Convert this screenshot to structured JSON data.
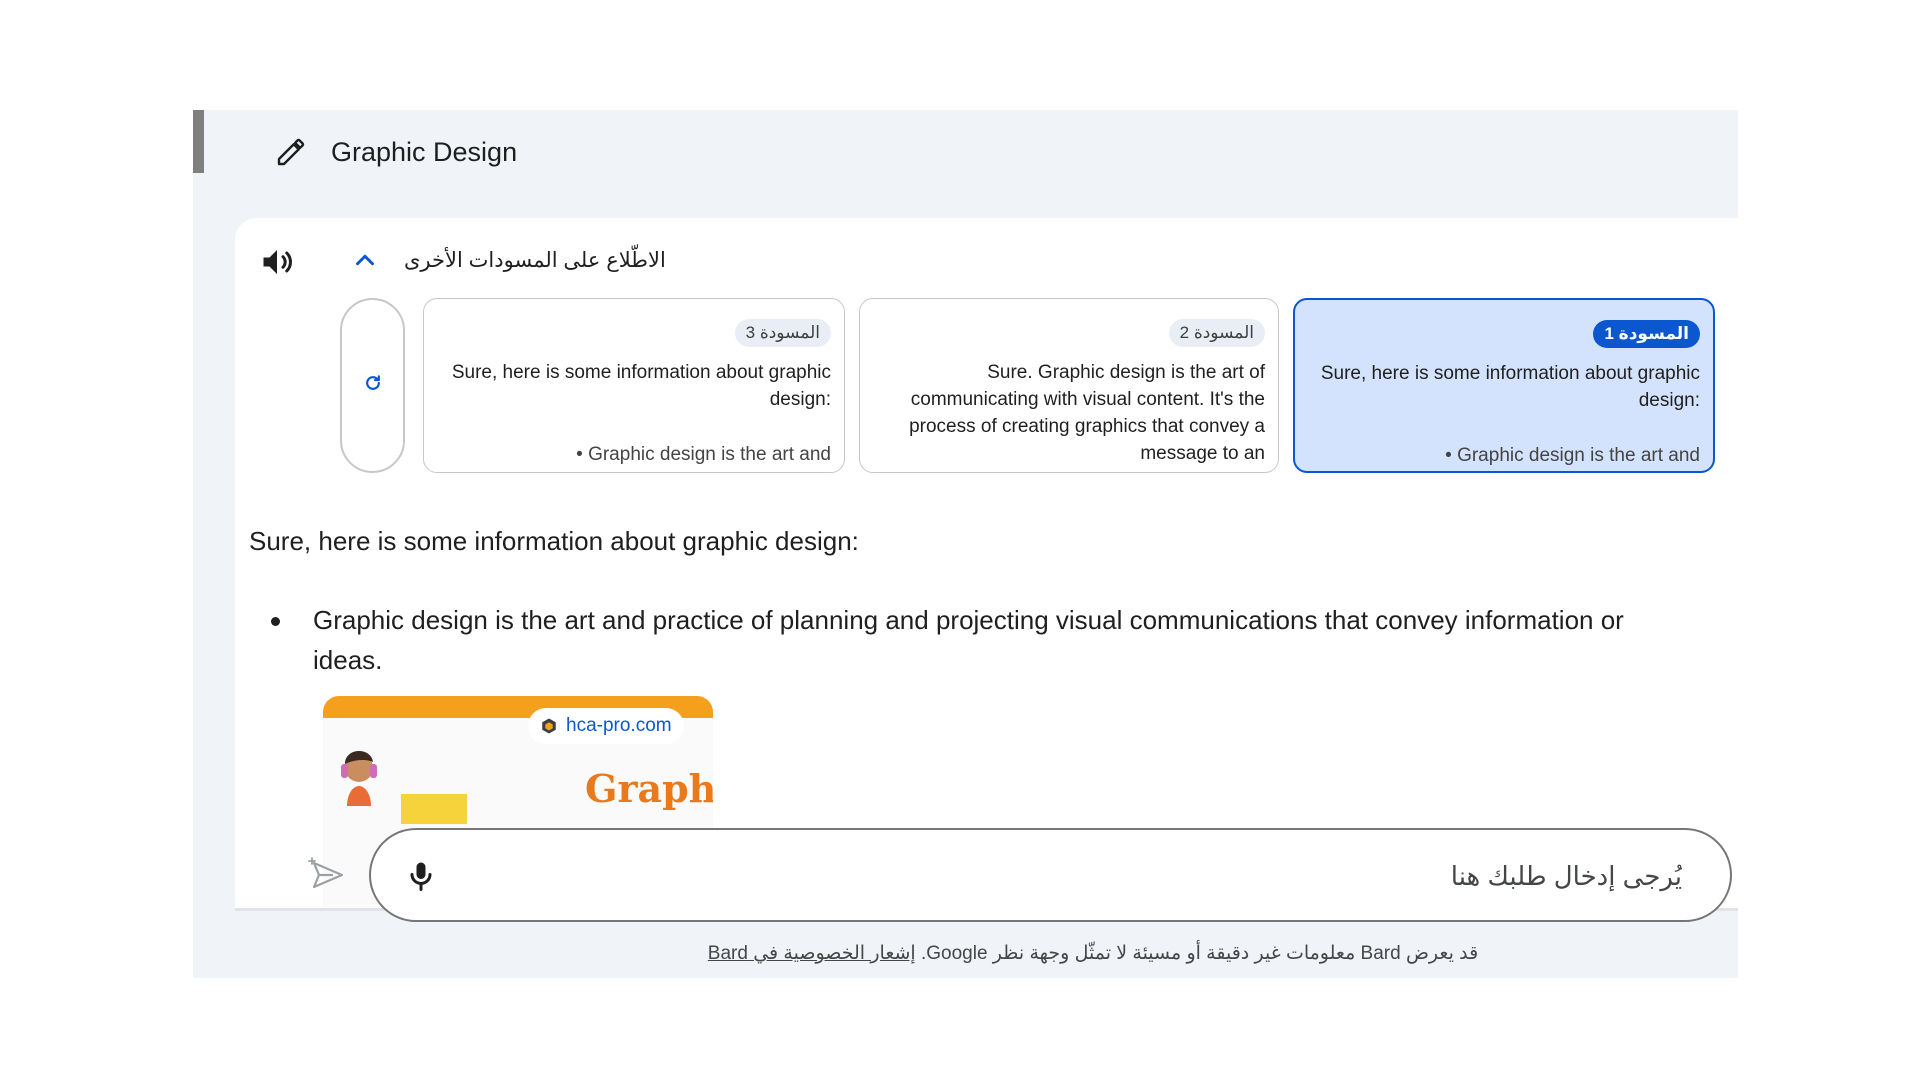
{
  "header": {
    "title": "Graphic Design",
    "edit_icon": "pencil-icon"
  },
  "drafts": {
    "toggle_label": "الاطّلاع على المسودات الأخرى",
    "toggle_icon": "chevron-up-icon",
    "speaker_icon": "volume-icon",
    "regenerate_icon": "refresh-icon",
    "items": [
      {
        "badge": "المسودة 1",
        "text": "Sure, here is some information about graphic design:",
        "bullet_preview": "Graphic design is the art and",
        "selected": true
      },
      {
        "badge": "المسودة 2",
        "text": "Sure. Graphic design is the art of communicating with visual content. It's the process of creating graphics that convey a message to an",
        "selected": false
      },
      {
        "badge": "المسودة 3",
        "text": "Sure, here is some information about graphic design:",
        "bullet_preview": "Graphic design is the art and",
        "selected": false
      }
    ]
  },
  "response": {
    "intro": "Sure, here is some information about graphic design:",
    "bullets": [
      "Graphic design is the art and practice of planning and projecting visual communications that convey information or ideas."
    ],
    "image": {
      "source": "hca-pro.com",
      "headline": "Graphi"
    }
  },
  "prompt": {
    "placeholder": "يُرجى إدخال طلبك هنا",
    "value": "",
    "mic_icon": "microphone-icon",
    "send_icon": "send-icon"
  },
  "footer": {
    "disclaimer": "قد يعرض Bard معلومات غير دقيقة أو مسيئة لا تمثّل وجهة نظر Google.",
    "privacy_link": "إشعار الخصوصية في Bard"
  },
  "colors": {
    "accent": "#0b57d0",
    "panel_bg": "#f0f4f9",
    "selected_draft_bg": "#d3e3fd"
  }
}
